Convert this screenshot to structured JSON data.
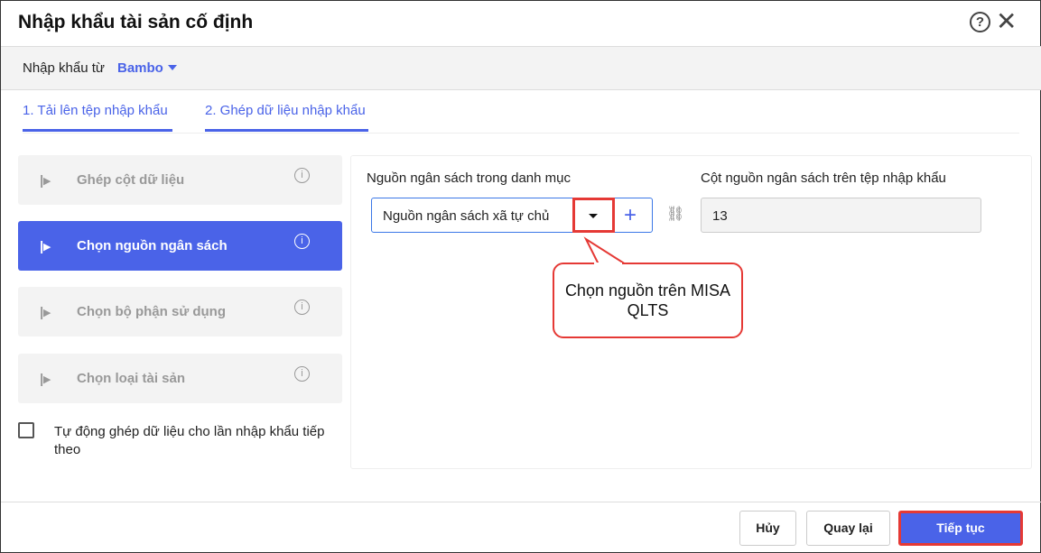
{
  "title": "Nhập khẩu tài sản cố định",
  "import_from": {
    "label": "Nhập khẩu từ",
    "value": "Bambo"
  },
  "tabs": [
    "1. Tải lên tệp nhập khẩu",
    "2. Ghép dữ liệu nhập khẩu"
  ],
  "steps": [
    "Ghép cột dữ liệu",
    "Chọn nguồn ngân sách",
    "Chọn bộ phận sử dụng",
    "Chọn loại tài sản"
  ],
  "auto_match_label": "Tự động ghép dữ liệu cho lần nhập khẩu tiếp theo",
  "source_label": "Nguồn ngân sách trong danh mục",
  "source_value": "Nguồn ngân sách xã tự chủ",
  "column_label": "Cột nguồn ngân sách trên tệp nhập khẩu",
  "column_value": "13",
  "callout": "Chọn nguồn trên MISA QLTS",
  "buttons": {
    "cancel": "Hủy",
    "back": "Quay lại",
    "next": "Tiếp tục"
  }
}
